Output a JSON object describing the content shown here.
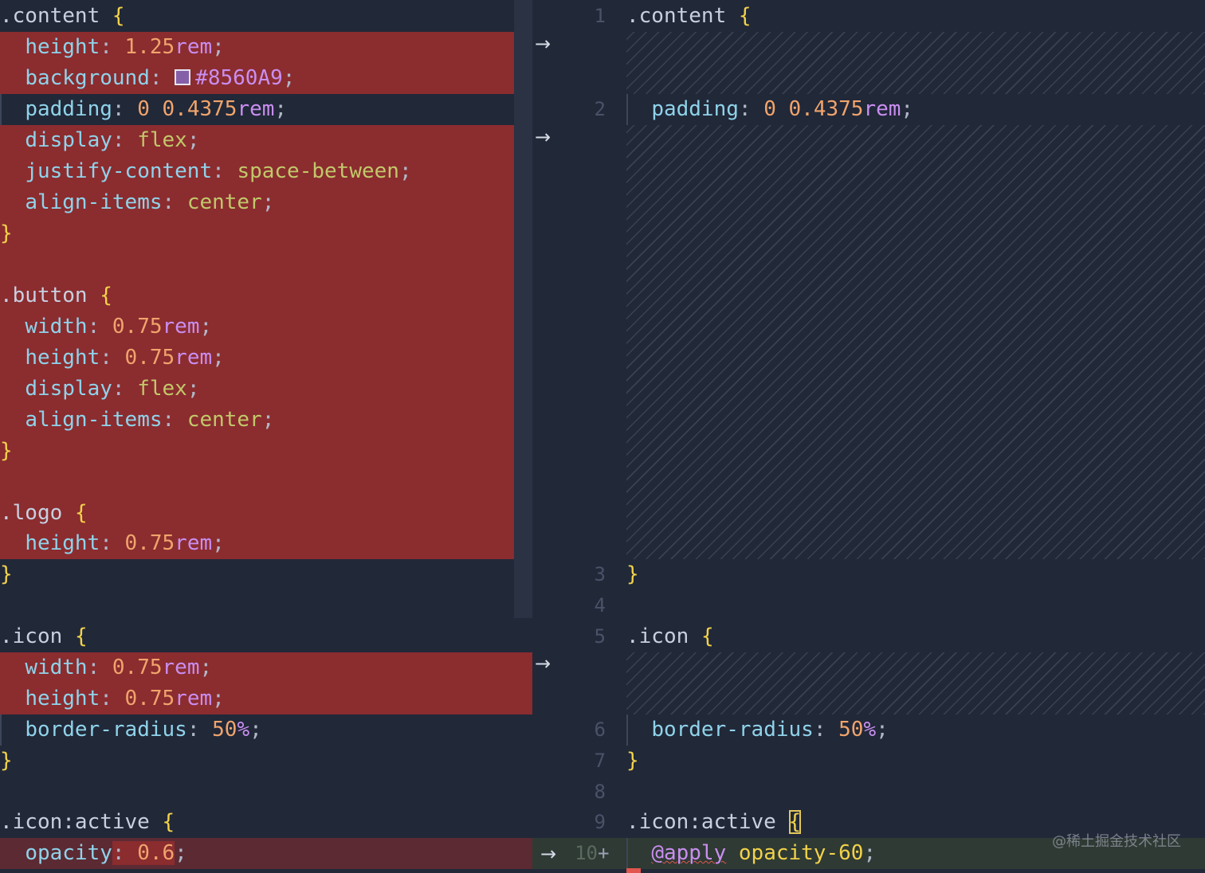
{
  "left_code": {
    "l1_sel": ".content",
    "brace_open": "{",
    "brace_close": "}",
    "height_prop": "height",
    "background_prop": "background",
    "padding_prop": "padding",
    "display_prop": "display",
    "justify_prop": "justify-content",
    "align_prop": "align-items",
    "width_prop": "width",
    "border_radius_prop": "border-radius",
    "opacity_prop": "opacity",
    "colon": ":",
    "semicolon": ";",
    "v_125": "1.25",
    "v_075": "0.75",
    "v_0": "0",
    "v_04375": "0.4375",
    "unit_rem": "rem",
    "hash_value": "#8560A9",
    "flex": "flex",
    "space_between": "space-between",
    "center": "center",
    "button_sel": ".button",
    "logo_sel": ".logo",
    "icon_sel": ".icon",
    "icon_active_sel": ".icon:active",
    "v_50": "50",
    "unit_pct": "%",
    "v_06": "0.6"
  },
  "right_code": {
    "content_sel": ".content",
    "padding_prop": "padding",
    "icon_sel": ".icon",
    "border_radius_prop": "border-radius",
    "icon_active_sel": ".icon:active",
    "at_apply": "@apply",
    "opacity_class": "opacity-60",
    "line_numbers": [
      "1",
      "2",
      "3",
      "4",
      "5",
      "6",
      "7",
      "8",
      "9",
      "10"
    ],
    "added_marker": "+"
  },
  "gutter": {
    "arrow": "→"
  },
  "watermark": "@稀土掘金技术社区",
  "colors": {
    "removed": "#8b2c2f",
    "added": "#2f3a34",
    "background": "#212838",
    "swatch": "#8560A9"
  }
}
